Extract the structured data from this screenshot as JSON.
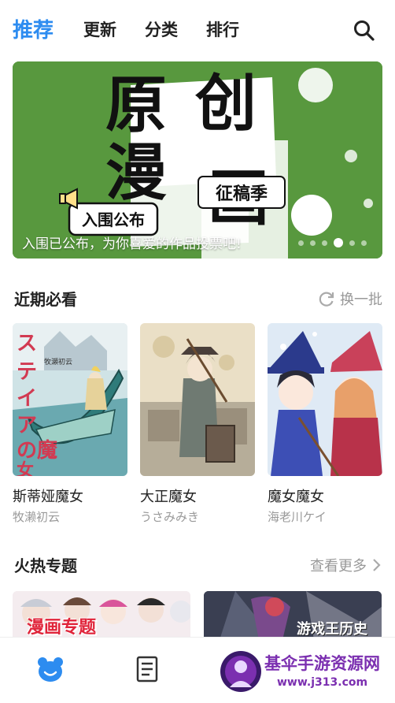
{
  "nav": {
    "tabs": [
      {
        "label": "推荐",
        "active": true
      },
      {
        "label": "更新",
        "active": false
      },
      {
        "label": "分类",
        "active": false
      },
      {
        "label": "排行",
        "active": false
      }
    ],
    "search_icon": "search-icon"
  },
  "banner": {
    "art_text": {
      "line1a": "原",
      "line1b": "创",
      "line2a": "漫",
      "line2b": "画",
      "tag": "征稿季",
      "badge": "入围公布"
    },
    "caption": "入围已公布，为你喜爱的作品投票吧!",
    "dot_count": 5,
    "active_dot": 3
  },
  "recent": {
    "title": "近期必看",
    "action_label": "换一批",
    "action_icon": "refresh-icon",
    "items": [
      {
        "title": "斯蒂娅魔女",
        "author": "牧濑初云",
        "cover_text": "ステイアの魔女",
        "cover_tag": "牧瀬初云"
      },
      {
        "title": "大正魔女",
        "author": "うさみみき"
      },
      {
        "title": "魔女魔女",
        "author": "海老川ケイ"
      }
    ]
  },
  "hot": {
    "title": "火热专题",
    "action_label": "查看更多",
    "action_icon": "chevron-right-icon",
    "topics": [
      {
        "label": "漫画专题"
      },
      {
        "label": "游戏王历史"
      }
    ]
  },
  "bottom_nav": {
    "items": [
      {
        "icon": "bear-home-icon",
        "active": true
      },
      {
        "icon": "book-list-icon",
        "active": false
      }
    ]
  },
  "watermark": {
    "line1": "基伞手游资源网",
    "line2": "www.j313.com"
  },
  "colors": {
    "accent": "#2d8cf0",
    "banner_green": "#5a9a3e",
    "muted": "#999999",
    "watermark": "#7b2fb0"
  }
}
